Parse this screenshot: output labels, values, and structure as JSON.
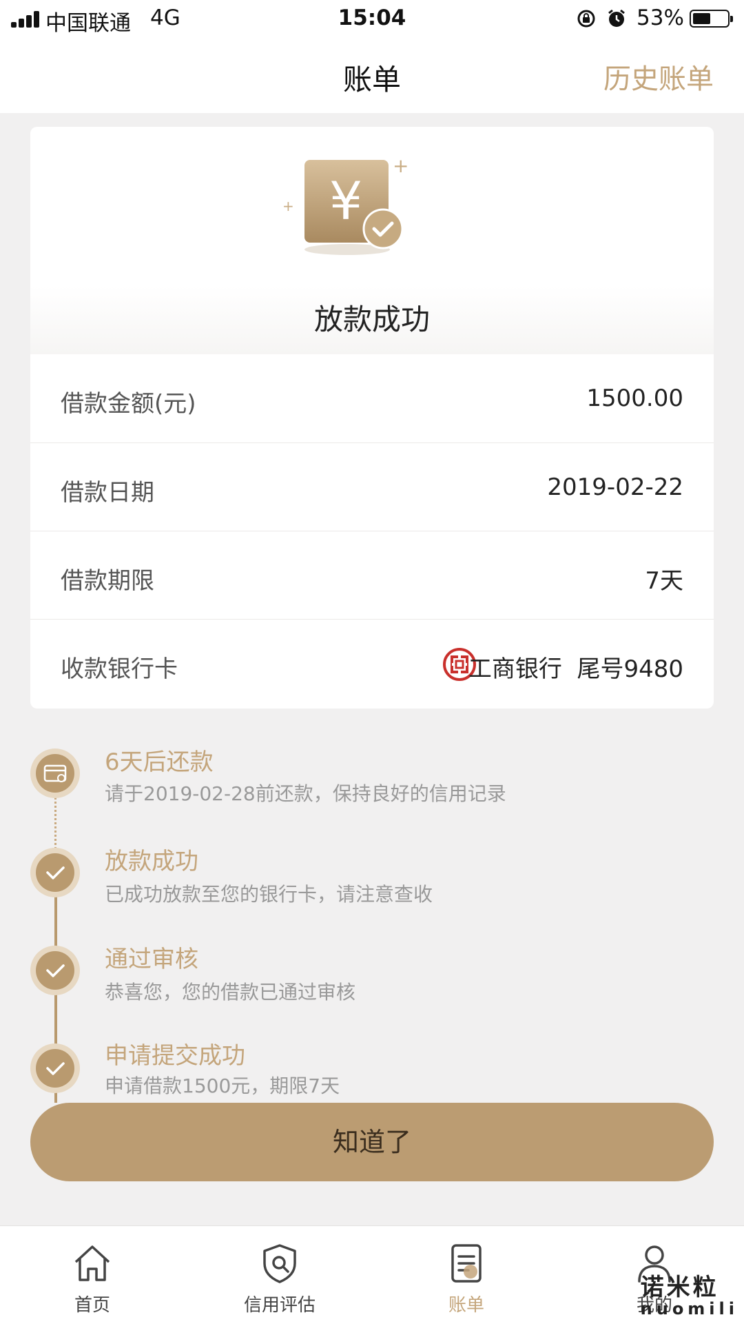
{
  "status_bar": {
    "carrier": "中国联通",
    "network": "4G",
    "time": "15:04",
    "battery_percent": "53%",
    "battery_level": 0.53
  },
  "nav": {
    "title": "账单",
    "history_label": "历史账单"
  },
  "hero": {
    "title": "放款成功",
    "icon": "yuan-check-icon"
  },
  "details": [
    {
      "label": "借款金额(元)",
      "value": "1500.00"
    },
    {
      "label": "借款日期",
      "value": "2019-02-22"
    },
    {
      "label": "借款期限",
      "value": "7天"
    },
    {
      "label": "收款银行卡",
      "bank_name": "工商银行",
      "card_tail": "尾号9480"
    }
  ],
  "timeline": [
    {
      "title": "6天后还款",
      "desc": "请于2019-02-28前还款，保持良好的信用记录",
      "icon": "card-icon"
    },
    {
      "title": "放款成功",
      "desc": "已成功放款至您的银行卡，请注意查收",
      "icon": "check-icon"
    },
    {
      "title": "通过审核",
      "desc": "恭喜您，您的借款已通过审核",
      "icon": "check-icon"
    },
    {
      "title": "申请提交成功",
      "desc": "申请借款1500元，期限7天",
      "icon": "check-icon"
    }
  ],
  "confirm_button": "知道了",
  "tab_bar": [
    {
      "label": "首页",
      "icon": "home-icon"
    },
    {
      "label": "信用评估",
      "icon": "shield-icon"
    },
    {
      "label": "账单",
      "icon": "bill-icon",
      "active": true
    },
    {
      "label": "我的",
      "icon": "user-icon"
    }
  ],
  "watermark": {
    "cn": "诺米粒",
    "en": "nuomili"
  },
  "colors": {
    "accent": "#c4a57b",
    "button": "#bb9c72",
    "background": "#f1f0f0",
    "bank_red": "#c9302c"
  }
}
